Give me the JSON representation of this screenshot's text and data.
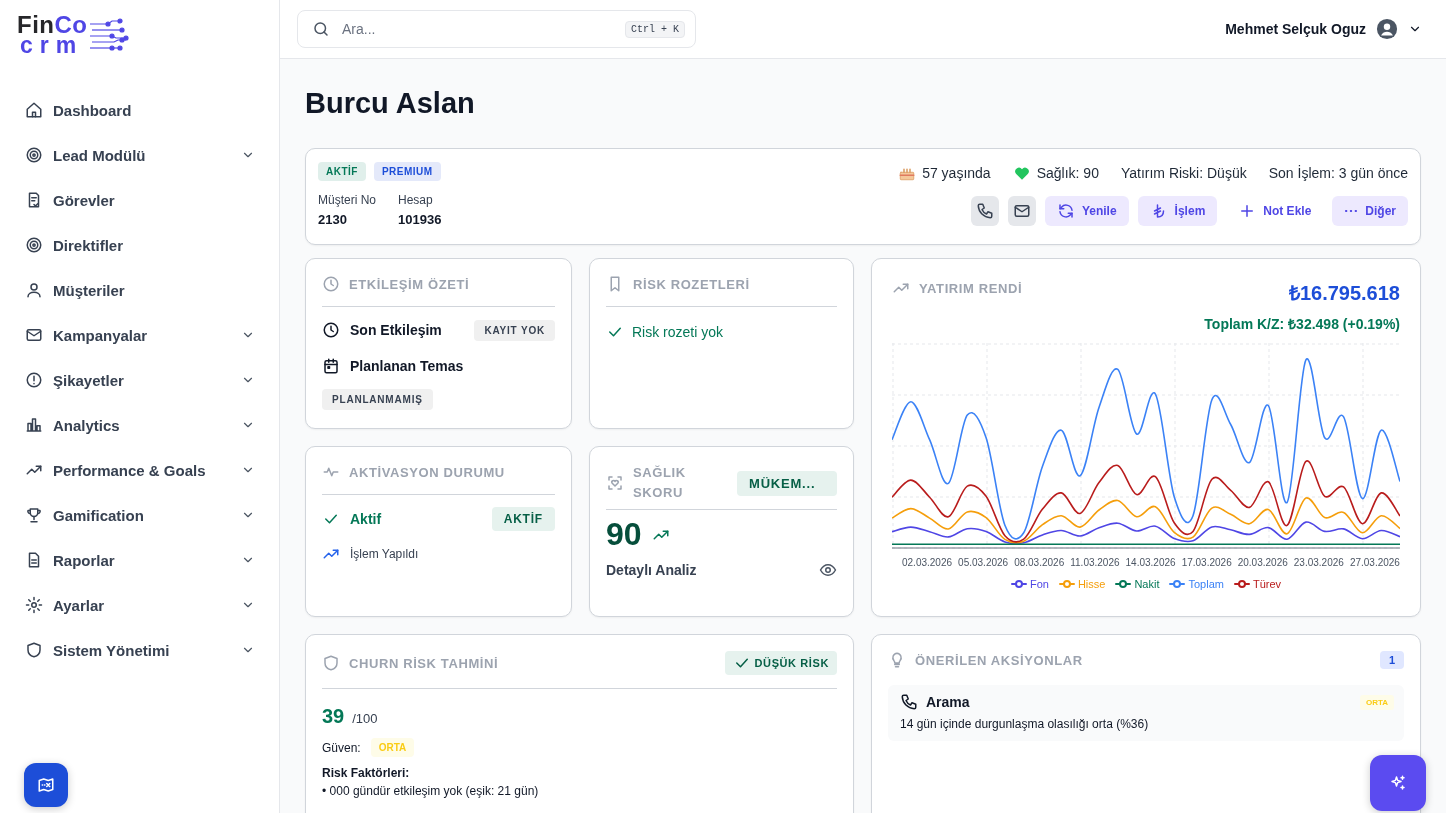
{
  "logo": {
    "word_start": "Fin",
    "word_end": "Co",
    "subtitle": "crm"
  },
  "sidebar": {
    "items": [
      {
        "label": "Dashboard",
        "has_submenu": false
      },
      {
        "label": "Lead Modülü",
        "has_submenu": true
      },
      {
        "label": "Görevler",
        "has_submenu": false
      },
      {
        "label": "Direktifler",
        "has_submenu": false
      },
      {
        "label": "Müşteriler",
        "has_submenu": false
      },
      {
        "label": "Kampanyalar",
        "has_submenu": true
      },
      {
        "label": "Şikayetler",
        "has_submenu": true
      },
      {
        "label": "Analytics",
        "has_submenu": true
      },
      {
        "label": "Performance & Goals",
        "has_submenu": true
      },
      {
        "label": "Gamification",
        "has_submenu": true
      },
      {
        "label": "Raporlar",
        "has_submenu": true
      },
      {
        "label": "Ayarlar",
        "has_submenu": true
      },
      {
        "label": "Sistem Yönetimi",
        "has_submenu": true
      }
    ]
  },
  "header": {
    "search": {
      "placeholder": "Ara...",
      "shortcut": "Ctrl + K"
    },
    "user": "Mehmet Selçuk Oguz"
  },
  "page_title": "Burcu Aslan",
  "profile": {
    "badges": [
      {
        "label": "AKTİF",
        "color": "#047857"
      },
      {
        "label": "PREMIUM",
        "color": "#1d4ed8"
      }
    ],
    "fields": [
      {
        "label": "Müşteri No",
        "value": "2130"
      },
      {
        "label": "Hesap",
        "value": "101936"
      }
    ],
    "stats": [
      {
        "kind": "age",
        "text": "57 yaşında"
      },
      {
        "kind": "health",
        "text": "Sağlık: 90"
      },
      {
        "kind": "plain",
        "text": "Yatırım Riski: Düşük"
      },
      {
        "kind": "plain",
        "text": "Son İşlem: 3 gün önce"
      }
    ],
    "actions": [
      {
        "kind": "phone"
      },
      {
        "kind": "mail"
      },
      {
        "kind": "refresh",
        "label": "Yenile"
      },
      {
        "kind": "lira",
        "label": "İşlem"
      },
      {
        "kind": "plus",
        "label": "Not Ekle"
      },
      {
        "kind": "more",
        "label": "Diğer"
      }
    ]
  },
  "interaction_summary": {
    "title": "ETKİLEŞİM ÖZETİ",
    "last_interaction": {
      "label": "Son Etkileşim",
      "badge": "KAYIT YOK"
    },
    "planned_contact": {
      "label": "Planlanan Temas",
      "badge": "PLANLANMAMIŞ"
    }
  },
  "risk_badges": {
    "title": "RİSK ROZETLERİ",
    "message": "Risk rozeti yok"
  },
  "activation": {
    "title": "AKTİVASYON DURUMU",
    "status": "Aktif",
    "badge": "AKTİF",
    "note": "İşlem Yapıldı"
  },
  "health_score": {
    "title": "SAĞLIK SKORU",
    "badge": "MÜKEM...",
    "score": "90",
    "link": "Detaylı Analiz"
  },
  "investment": {
    "title": "YATIRIM RENDİ",
    "total": "₺16.795.618",
    "profit": "Toplam K/Z: ₺32.498 (+0.19%)",
    "x_labels": [
      "02.03.2026",
      "05.03.2026",
      "08.03.2026",
      "11.03.2026",
      "14.03.2026",
      "17.03.2026",
      "20.03.2026",
      "23.03.2026",
      "27.03.2026"
    ],
    "legend": [
      {
        "name": "Fon",
        "color": "#4f46e5"
      },
      {
        "name": "Hisse",
        "color": "#f59e0b"
      },
      {
        "name": "Nakit",
        "color": "#047857"
      },
      {
        "name": "Toplam",
        "color": "#3b82f6"
      },
      {
        "name": "Türev",
        "color": "#b91c1c"
      }
    ]
  },
  "churn": {
    "title": "CHURN RİSK TAHMİNİ",
    "badge": "DÜŞÜK RİSK",
    "score": "39",
    "max": "/100",
    "confidence_label": "Güven:",
    "confidence": "ORTA",
    "factors_title": "Risk Faktörleri:",
    "factors": [
      "• 000 gündür etkileşim yok (eşik: 21 gün)"
    ]
  },
  "suggested_actions": {
    "title": "ÖNERİLEN AKSİYONLAR",
    "count": "1",
    "items": [
      {
        "title": "Arama",
        "priority": "ORTA",
        "description": "14 gün içinde durgunlaşma olasılığı orta (%36)"
      }
    ]
  }
}
